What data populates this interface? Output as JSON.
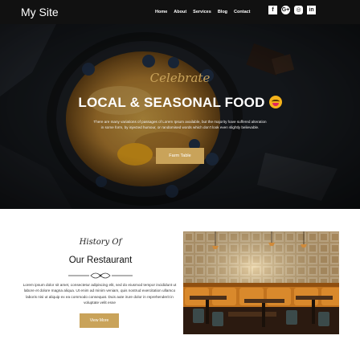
{
  "site": {
    "name": "My Site"
  },
  "nav": {
    "items": [
      "Home",
      "About",
      "Services",
      "Blog",
      "Contact"
    ]
  },
  "socials": [
    {
      "icon": "facebook-icon",
      "glyph": "f"
    },
    {
      "icon": "google-plus-icon",
      "glyph": "G+"
    },
    {
      "icon": "instagram-icon",
      "glyph": "◎"
    },
    {
      "icon": "linkedin-icon",
      "glyph": "in"
    }
  ],
  "hero": {
    "script": "Celebrate",
    "title": "LOCAL & SEASONAL FOOD",
    "emoji": "smiling-face-emoji",
    "body": "There are many variations of passages of Lorem Ipsum available, but the majority have suffered alteration in some form, by injected humour, or randomised words which don't look even slightly believable.",
    "button": "Farm Table"
  },
  "about": {
    "script": "History Of",
    "title": "Our Restaurant",
    "body": "Lorem ipsum dolor sit amet, consectetur adipiscing elit, sed do eiusmod tempor incididunt ut labore et dolore magna aliqua. Ut enim ad minim veniam, quis nostrud exercitation ullamco laboris nisi ut aliquip ex ea commodo consequat. Duis aute irure dolor in reprehenderit in voluptate velit esse",
    "button": "View More"
  },
  "colors": {
    "accent": "#c9a35a",
    "nav_bg": "#111111"
  }
}
